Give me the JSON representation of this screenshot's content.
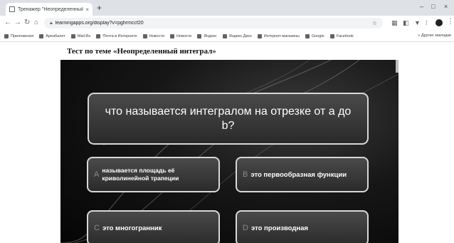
{
  "browser": {
    "tab_title": "Тренажер \"Неопределенный…",
    "tab_close": "×",
    "new_tab": "+",
    "url": "learningapps.org/display?v=pghrmccf20",
    "window_controls": [
      "–",
      "□",
      "×"
    ]
  },
  "bookmarks": {
    "items": [
      "Приложения",
      "Ареабалет",
      "Mail.Ru",
      "Почта в Интернете",
      "Новости",
      "Новости",
      "Яндекс",
      "Яндекс.Диск",
      "Интернет-магазины",
      "Google",
      "Facebook"
    ],
    "more": "»  Другие закладки"
  },
  "page": {
    "heading": "Тест по теме «Неопределенный интеграл»"
  },
  "quiz": {
    "question": "что называется интегралом на отрезке от a до b?",
    "answers": [
      {
        "letter": "A",
        "text": "называется площадь её криволинейной трапеции"
      },
      {
        "letter": "B",
        "text": "это первообразная функции"
      },
      {
        "letter": "C",
        "text": "это многогранник"
      },
      {
        "letter": "D",
        "text": "это производная"
      }
    ]
  },
  "colors": {
    "tile_border": "#d8d8d8",
    "quiz_background": "#111111",
    "chrome_tabstrip": "#dee1e6"
  }
}
